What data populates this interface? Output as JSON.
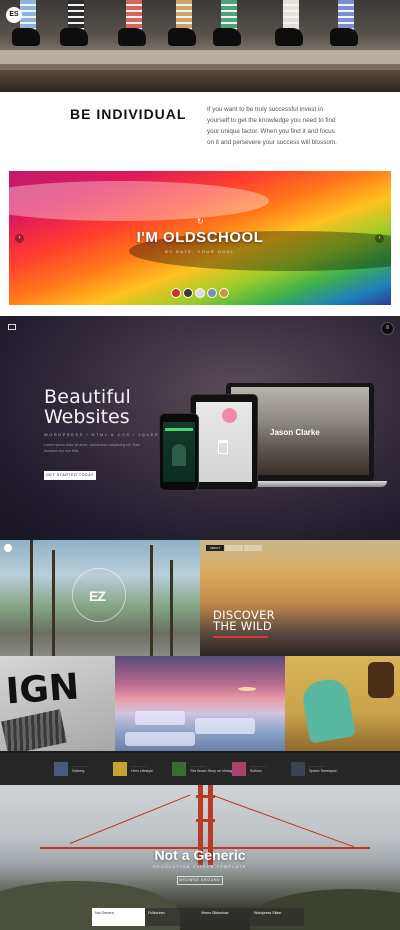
{
  "socks_section": {
    "logo": "ES",
    "socks": [
      {
        "color": "#8fb3d9"
      },
      {
        "color": "#2c2c2c"
      },
      {
        "color": "#d8645b"
      },
      {
        "color": "#c9a56a"
      },
      {
        "color": "#4fa37a"
      },
      {
        "color": "#e5e1d8"
      },
      {
        "color": "#7a8fd1"
      }
    ]
  },
  "individual": {
    "title": "BE INDIVIDUAL",
    "text": "If you want to be truly successful invest in yourself to get the knowledge you need to find your unique factor. When you find it and focus on it and persevere your success will blossom."
  },
  "slider": {
    "title": "I'M OLDSCHOOL",
    "subtitle": "BY DATE, YOUR GOAL",
    "prev_icon": "chevron-left-icon",
    "next_icon": "chevron-right-icon",
    "thumbs": [
      "#c8342d",
      "#3b3b3b",
      "#d9d9d9",
      "#7d8fa3",
      "#c49a3a"
    ]
  },
  "websites": {
    "title_line1": "Beautiful",
    "title_line2": "Websites",
    "tagline": "WORDPRESS / HTML & CSS / JQUERY",
    "description": "Lorem ipsum dolor sit amet, consectetur adipiscing elit. Nam tincidunt nisi non felis.",
    "button": "GET STARTED TODAY",
    "laptop_title": "Jason Clarke",
    "menu_icon": "menu-icon"
  },
  "collage": {
    "palm_logo": "EZ",
    "discover_line1": "DISCOVER",
    "discover_line2": "THE WILD",
    "sunset_tabs": [
      "ABOUT",
      "",
      ""
    ],
    "sign_text": "IGN"
  },
  "product_strip": {
    "items": [
      {
        "title": "Solberg",
        "meta": "—— ———",
        "color": "#4a5a7a"
      },
      {
        "title": "Hero Lifestyle",
        "meta": "—— ———",
        "color": "#c9a12f"
      },
      {
        "title": "The Brush Story on Vintage",
        "meta": "—— ———",
        "color": "#3b6a35"
      },
      {
        "title": "Sulfuric",
        "meta": "—— ———",
        "color": "#a8416e"
      },
      {
        "title": "Speed Timelapse",
        "meta": "—— ———",
        "color": "#3a4452"
      }
    ]
  },
  "gate": {
    "title": "Not a Generic",
    "subtitle": "REVOLUTION SLIDER TEMPLATE",
    "button": "BROWSE AROUND",
    "tabs": [
      "Not Generic",
      "Fullscreen",
      "Vimeo Slideshow",
      "Wordpress Slider"
    ]
  }
}
